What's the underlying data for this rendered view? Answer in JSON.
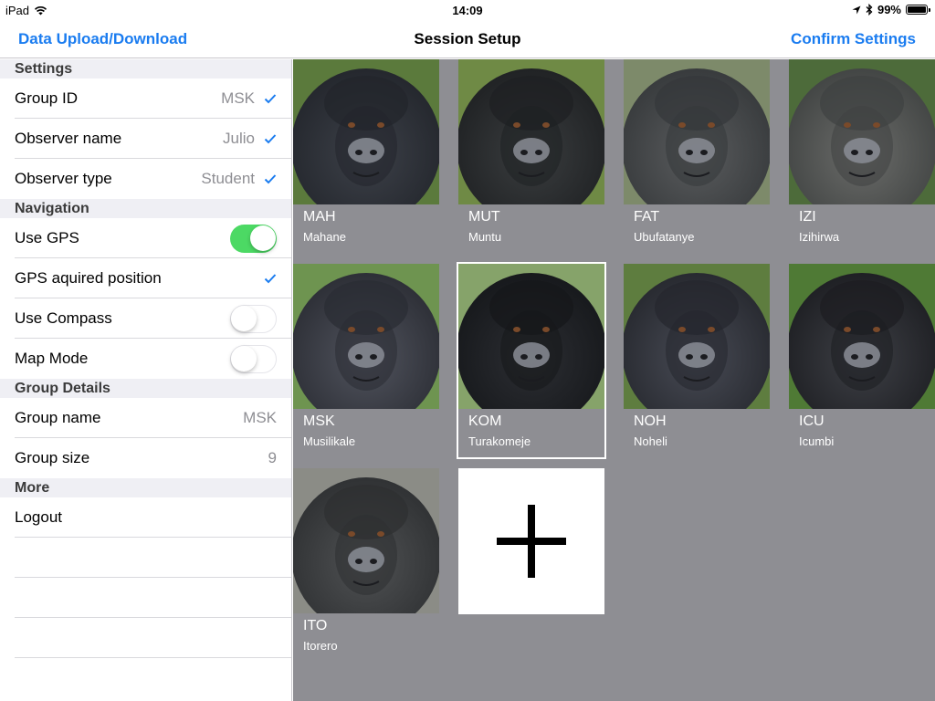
{
  "status": {
    "device": "iPad",
    "time": "14:09",
    "battery": "99%",
    "battery_level": 0.99
  },
  "nav": {
    "left": "Data Upload/Download",
    "title": "Session Setup",
    "right": "Confirm Settings"
  },
  "settings": {
    "header": "Settings",
    "group_id": {
      "label": "Group ID",
      "value": "MSK"
    },
    "observer_name": {
      "label": "Observer name",
      "value": "Julio"
    },
    "observer_type": {
      "label": "Observer type",
      "value": "Student"
    }
  },
  "navigation": {
    "header": "Navigation",
    "use_gps": {
      "label": "Use GPS",
      "on": true
    },
    "gps_position": {
      "label": "GPS aquired position"
    },
    "use_compass": {
      "label": "Use Compass",
      "on": false
    },
    "map_mode": {
      "label": "Map Mode",
      "on": false
    }
  },
  "group_details": {
    "header": "Group Details",
    "group_name": {
      "label": "Group name",
      "value": "MSK"
    },
    "group_size": {
      "label": "Group size",
      "value": "9"
    }
  },
  "more": {
    "header": "More",
    "logout": "Logout"
  },
  "gorillas": [
    {
      "code": "MAH",
      "name": "Mahane",
      "selected": false
    },
    {
      "code": "MUT",
      "name": "Muntu",
      "selected": false
    },
    {
      "code": "FAT",
      "name": "Ubufatanye",
      "selected": false
    },
    {
      "code": "IZI",
      "name": "Izihirwa",
      "selected": false
    },
    {
      "code": "MSK",
      "name": "Musilikale",
      "selected": false
    },
    {
      "code": "KOM",
      "name": "Turakomeje",
      "selected": true
    },
    {
      "code": "NOH",
      "name": "Noheli",
      "selected": false
    },
    {
      "code": "ICU",
      "name": "Icumbi",
      "selected": false
    },
    {
      "code": "ITO",
      "name": "Itorero",
      "selected": false
    }
  ],
  "colors": {
    "accent": "#1a7cf0",
    "toggle_on": "#4cd964",
    "gallery_bg": "#8e8e93",
    "section_bg": "#efeff4"
  },
  "icons": {
    "wifi": "wifi-icon",
    "location": "location-arrow-icon",
    "bluetooth": "bluetooth-icon",
    "check": "checkmark-icon",
    "add": "plus-icon"
  }
}
